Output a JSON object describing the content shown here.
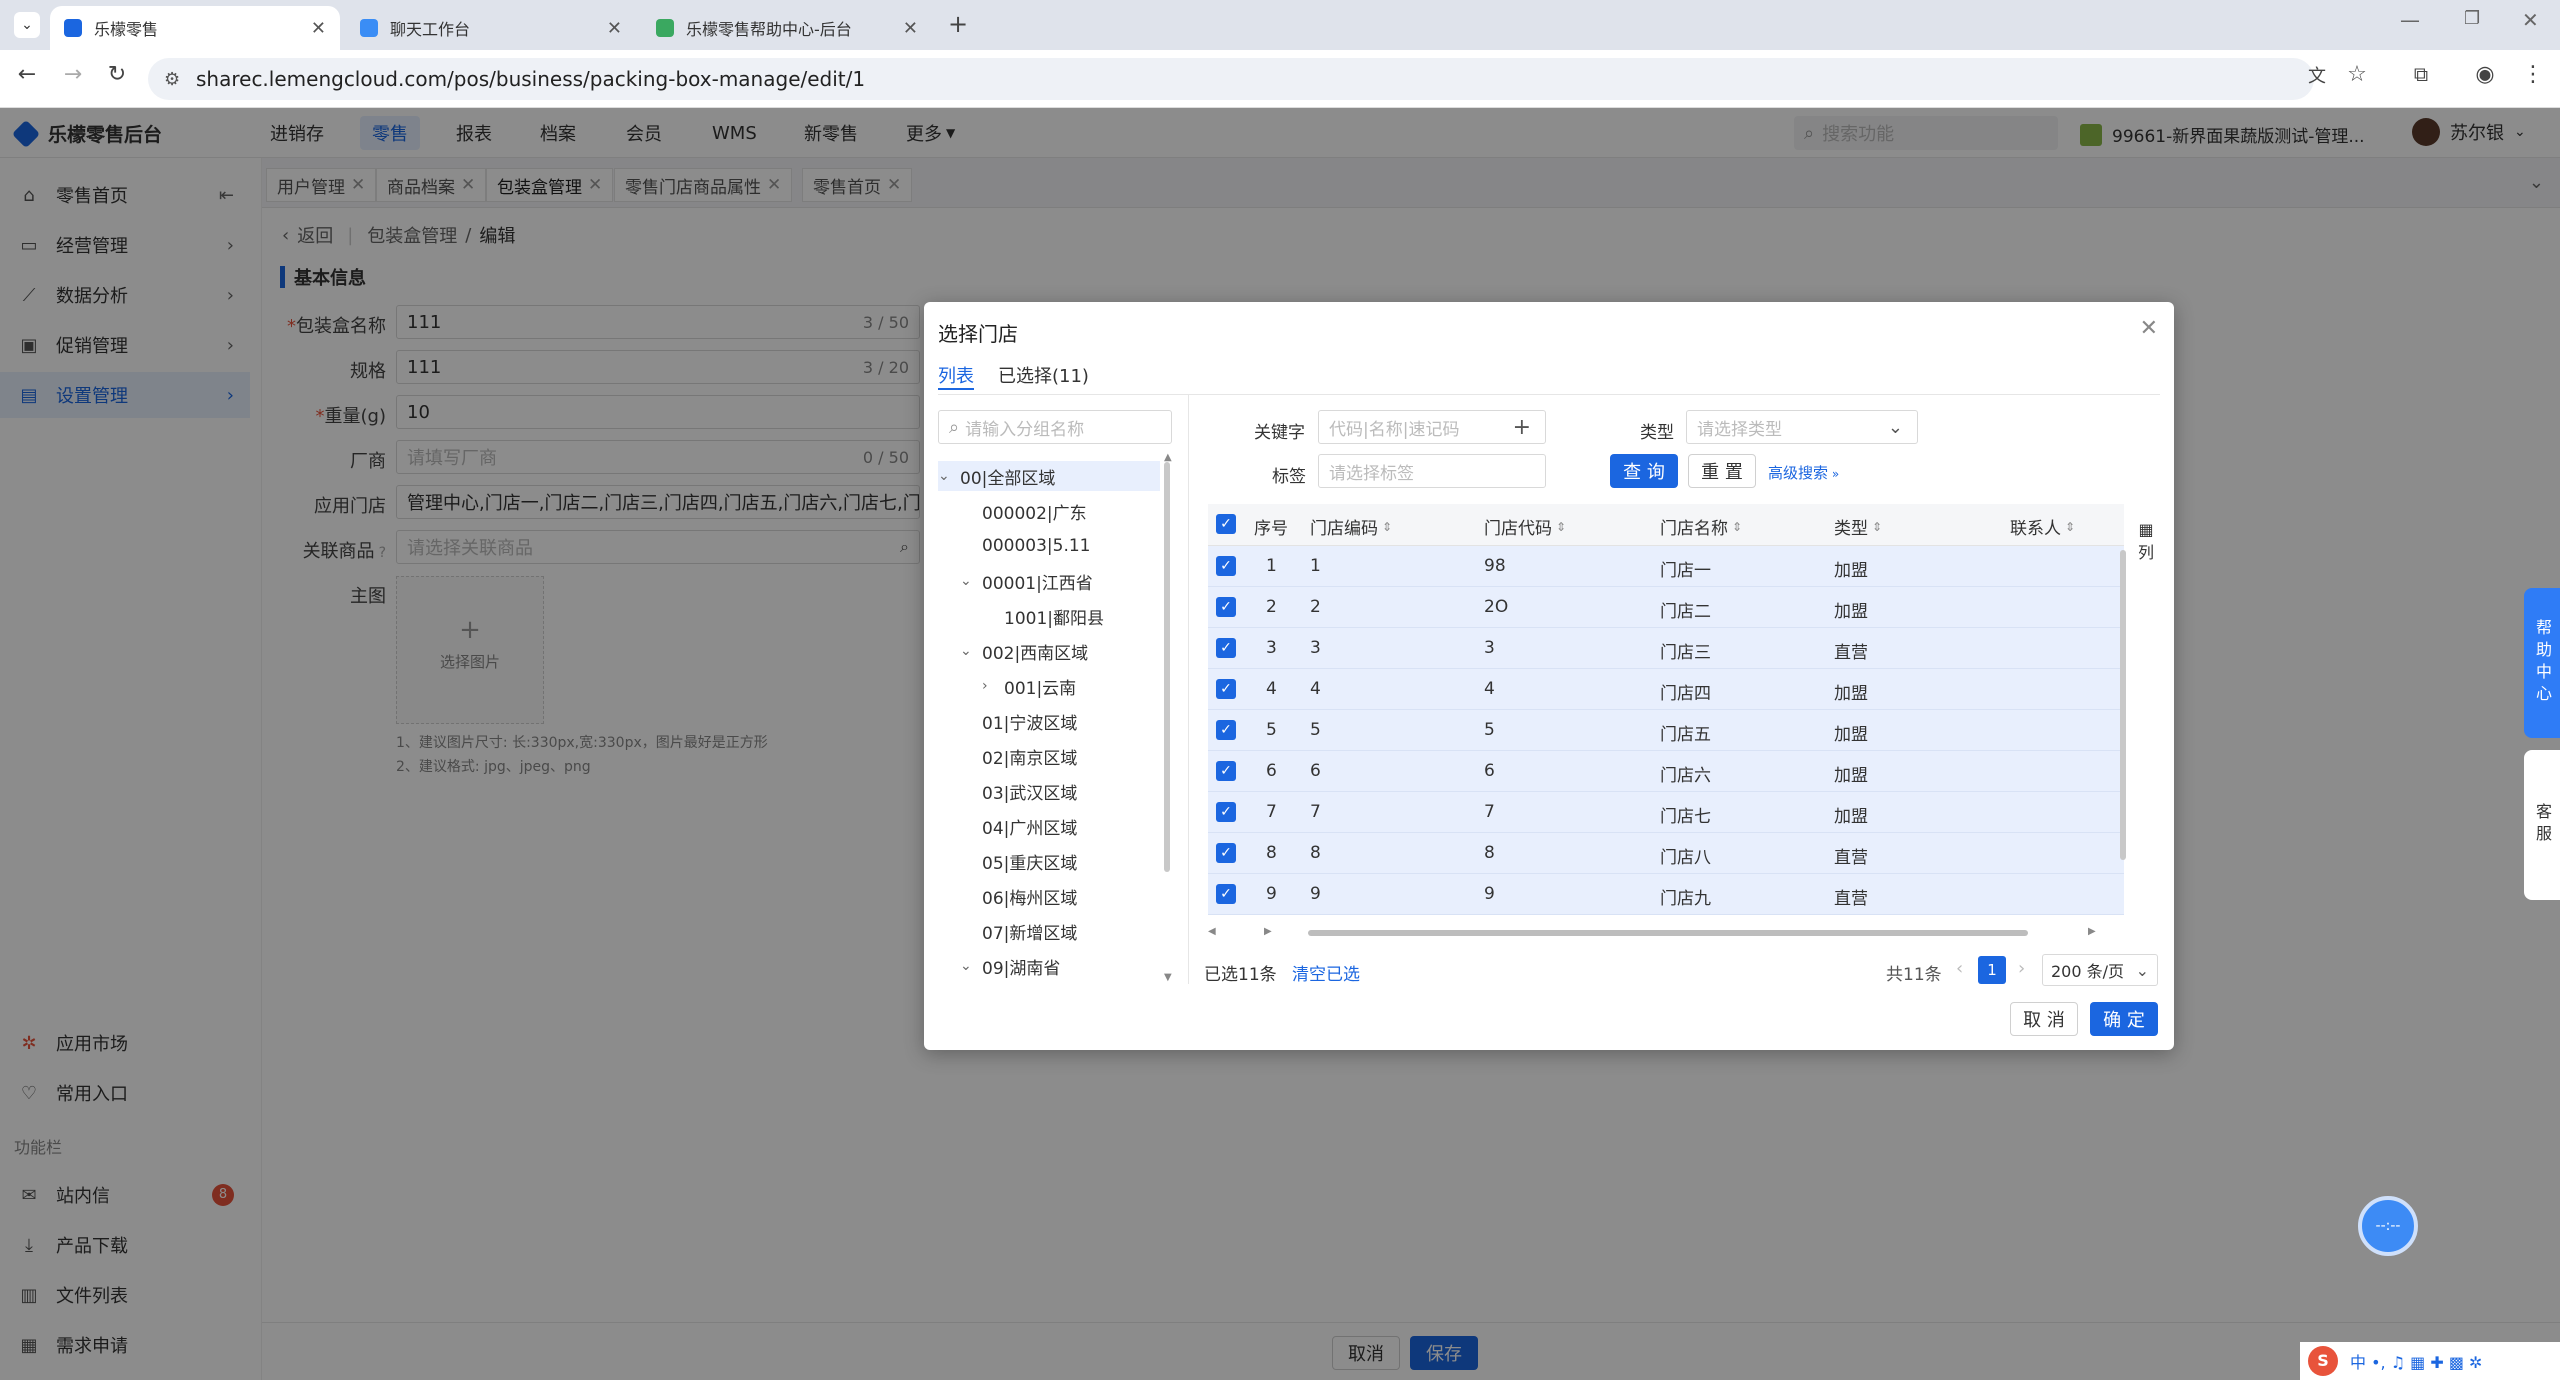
{
  "browser": {
    "tabs": [
      {
        "title": "乐檬零售",
        "active": true
      },
      {
        "title": "聊天工作台",
        "active": false
      },
      {
        "title": "乐檬零售帮助中心-后台",
        "active": false
      }
    ],
    "url": "sharec.lemengcloud.com/pos/business/packing-box-manage/edit/1"
  },
  "app": {
    "logo_text": "乐檬零售后台",
    "top_nav": [
      "进销存",
      "零售",
      "报表",
      "档案",
      "会员",
      "WMS",
      "新零售",
      "更多"
    ],
    "active_nav": "零售",
    "search_placeholder": "搜索功能",
    "store_text": "99661-新界面果蔬版测试-管理...",
    "user_name": "苏尔银"
  },
  "sidebar": {
    "items": [
      {
        "label": "零售首页",
        "icon": "home-icon"
      },
      {
        "label": "经营管理",
        "icon": "chart-board-icon"
      },
      {
        "label": "数据分析",
        "icon": "line-chart-icon"
      },
      {
        "label": "促销管理",
        "icon": "promotion-icon"
      },
      {
        "label": "设置管理",
        "icon": "settings-icon"
      }
    ],
    "bottom": [
      {
        "label": "应用市场",
        "icon": "app-market-icon"
      },
      {
        "label": "常用入口",
        "icon": "heart-icon"
      }
    ],
    "section_title": "功能栏",
    "func_items": [
      {
        "label": "站内信",
        "icon": "mail-icon",
        "badge": "8"
      },
      {
        "label": "产品下载",
        "icon": "download-icon"
      },
      {
        "label": "文件列表",
        "icon": "file-list-icon"
      },
      {
        "label": "需求申请",
        "icon": "request-icon"
      }
    ]
  },
  "page_tabs": [
    "用户管理",
    "商品档案",
    "包装盒管理",
    "零售门店商品属性",
    "零售首页"
  ],
  "breadcrumb": {
    "back": "返回",
    "parent": "包装盒管理",
    "current": "编辑"
  },
  "form": {
    "section_title": "基本信息",
    "fields": {
      "name": {
        "label": "包装盒名称",
        "value": "111",
        "count": "3 / 50"
      },
      "spec": {
        "label": "规格",
        "value": "111",
        "count": "3 / 20"
      },
      "weight": {
        "label": "重量(g)",
        "value": "10"
      },
      "vendor": {
        "label": "厂商",
        "placeholder": "请填写厂商",
        "count": "0 / 50"
      },
      "stores": {
        "label": "应用门店",
        "value": "管理中心,门店一,门店二,门店三,门店四,门店五,门店六,门店七,门"
      },
      "product": {
        "label": "关联商品",
        "placeholder": "请选择关联商品"
      },
      "image": {
        "label": "主图",
        "button": "选择图片"
      }
    },
    "hints": [
      "1、建议图片尺寸: 长:330px,宽:330px，图片最好是正方形",
      "2、建议格式: jpg、jpeg、png"
    ]
  },
  "footer": {
    "cancel": "取消",
    "save": "保存"
  },
  "dialog": {
    "title": "选择门店",
    "tabs": [
      "列表",
      "已选择(11)"
    ],
    "tree_search_placeholder": "请输入分组名称",
    "tree": [
      {
        "label": "00|全部区域",
        "level": 0,
        "expand": "open",
        "selected": true
      },
      {
        "label": "000002|广东",
        "level": 1,
        "expand": "none"
      },
      {
        "label": "000003|5.11",
        "level": 1,
        "expand": "none"
      },
      {
        "label": "00001|江西省",
        "level": 1,
        "expand": "open"
      },
      {
        "label": "1001|鄱阳县",
        "level": 2,
        "expand": "none"
      },
      {
        "label": "002|西南区域",
        "level": 1,
        "expand": "open"
      },
      {
        "label": "001|云南",
        "level": 2,
        "expand": "closed"
      },
      {
        "label": "01|宁波区域",
        "level": 1,
        "expand": "none"
      },
      {
        "label": "02|南京区域",
        "level": 1,
        "expand": "none"
      },
      {
        "label": "03|武汉区域",
        "level": 1,
        "expand": "none"
      },
      {
        "label": "04|广州区域",
        "level": 1,
        "expand": "none"
      },
      {
        "label": "05|重庆区域",
        "level": 1,
        "expand": "none"
      },
      {
        "label": "06|梅州区域",
        "level": 1,
        "expand": "none"
      },
      {
        "label": "07|新增区域",
        "level": 1,
        "expand": "none"
      },
      {
        "label": "09|湖南省",
        "level": 1,
        "expand": "open"
      }
    ],
    "filters": {
      "keyword_label": "关键字",
      "keyword_placeholder": "代码|名称|速记码",
      "type_label": "类型",
      "type_placeholder": "请选择类型",
      "tag_label": "标签",
      "tag_placeholder": "请选择标签",
      "query": "查 询",
      "reset": "重 置",
      "advanced": "高级搜索"
    },
    "columns": [
      "序号",
      "门店编码",
      "门店代码",
      "门店名称",
      "类型",
      "联系人"
    ],
    "column_setting": "列",
    "rows": [
      [
        "1",
        "1",
        "98",
        "门店一",
        "加盟"
      ],
      [
        "2",
        "2",
        "2O",
        "门店二",
        "加盟"
      ],
      [
        "3",
        "3",
        "3",
        "门店三",
        "直营"
      ],
      [
        "4",
        "4",
        "4",
        "门店四",
        "加盟"
      ],
      [
        "5",
        "5",
        "5",
        "门店五",
        "加盟"
      ],
      [
        "6",
        "6",
        "6",
        "门店六",
        "加盟"
      ],
      [
        "7",
        "7",
        "7",
        "门店七",
        "加盟"
      ],
      [
        "8",
        "8",
        "8",
        "门店八",
        "直营"
      ],
      [
        "9",
        "9",
        "9",
        "门店九",
        "直营"
      ]
    ],
    "selected_text": "已选11条",
    "clear_text": "清空已选",
    "total_text": "共11条",
    "current_page": "1",
    "page_size": "200 条/页",
    "cancel": "取 消",
    "confirm": "确 定"
  },
  "widgets": {
    "help": "帮助中心",
    "service": "客服"
  }
}
